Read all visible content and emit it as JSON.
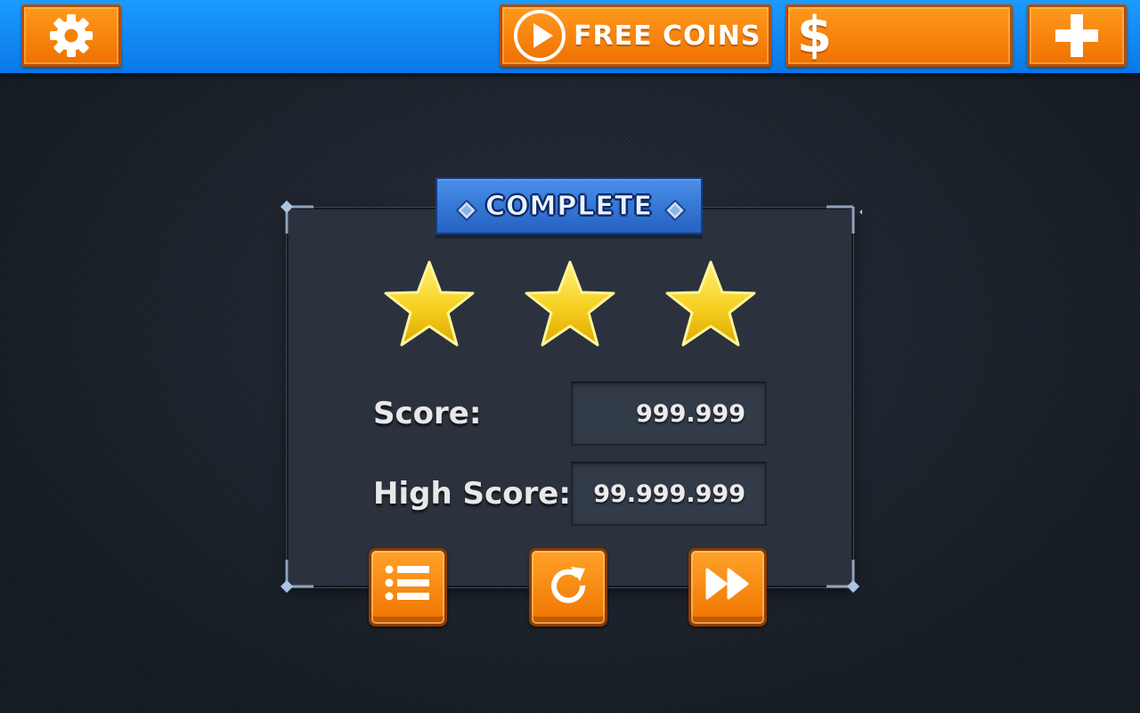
{
  "top_bar": {
    "settings_icon": "gear-icon",
    "free_coins": {
      "icon": "play-circle-icon",
      "label": "FREE COINS"
    },
    "currency": {
      "icon": "dollar-icon",
      "symbol": "$",
      "value": ""
    },
    "add_icon": "plus-icon"
  },
  "result": {
    "title": "COMPLETE",
    "stars_earned": 3,
    "stars_total": 3,
    "score_label": "Score:",
    "score_value": "999.999",
    "high_score_label": "High Score:",
    "high_score_value": "99.999.999"
  },
  "actions": [
    {
      "name": "level-list-button",
      "icon": "list-icon"
    },
    {
      "name": "retry-button",
      "icon": "refresh-icon"
    },
    {
      "name": "next-level-button",
      "icon": "fast-forward-icon"
    }
  ],
  "colors": {
    "accent_orange": "#f58200",
    "topbar_blue": "#0f85f0",
    "banner_blue": "#2f6fd0",
    "star_gold": "#f5d020",
    "panel_bg": "#2b323d"
  }
}
